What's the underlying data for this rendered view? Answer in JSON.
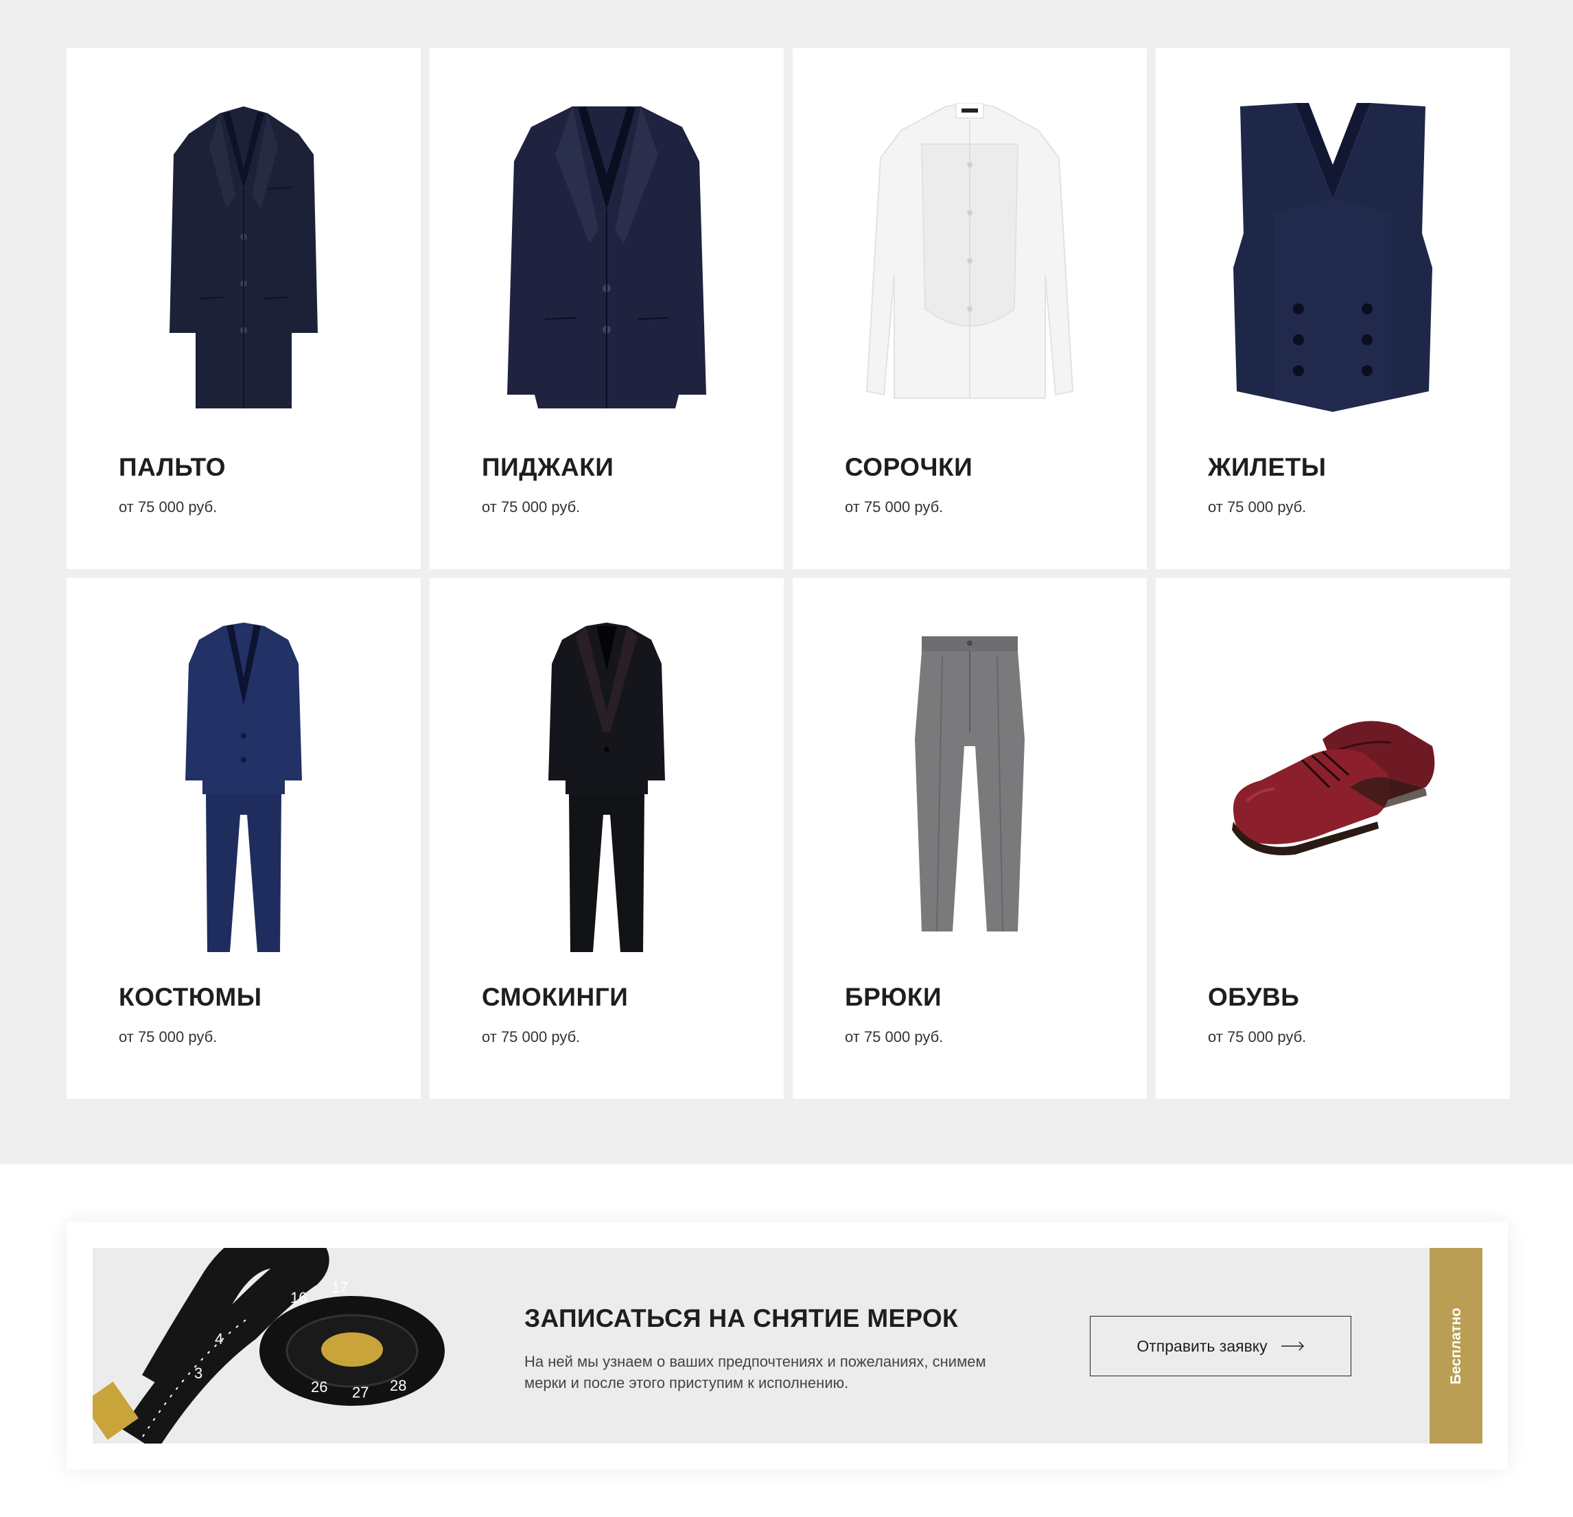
{
  "catalog": {
    "items": [
      {
        "name": "ПАЛЬТО",
        "price": "от 75 000 руб.",
        "icon": "coat-image"
      },
      {
        "name": "ПИДЖАКИ",
        "price": "от 75 000 руб.",
        "icon": "jacket-image"
      },
      {
        "name": "СОРОЧКИ",
        "price": "от 75 000 руб.",
        "icon": "shirt-image"
      },
      {
        "name": "ЖИЛЕТЫ",
        "price": "от 75 000 руб.",
        "icon": "vest-image"
      },
      {
        "name": "КОСТЮМЫ",
        "price": "от 75 000 руб.",
        "icon": "suit-image"
      },
      {
        "name": "СМОКИНГИ",
        "price": "от 75 000 руб.",
        "icon": "tuxedo-image"
      },
      {
        "name": "БРЮКИ",
        "price": "от 75 000 руб.",
        "icon": "trousers-image"
      },
      {
        "name": "ОБУВЬ",
        "price": "от 75 000 руб.",
        "icon": "shoes-image"
      }
    ]
  },
  "promo": {
    "title": "ЗАПИСАТЬСЯ НА СНЯТИЕ МЕРОК",
    "description": "На ней мы узнаем о ваших предпочтениях и пожеланиях, снимем мерки и после этого приступим к исполнению.",
    "button_label": "Отправить заявку",
    "badge": "Бесплатно",
    "image": "measuring-tape-image"
  },
  "colors": {
    "background": "#efefef",
    "card": "#ffffff",
    "accent": "#b99e53",
    "text": "#1e1e1e"
  }
}
